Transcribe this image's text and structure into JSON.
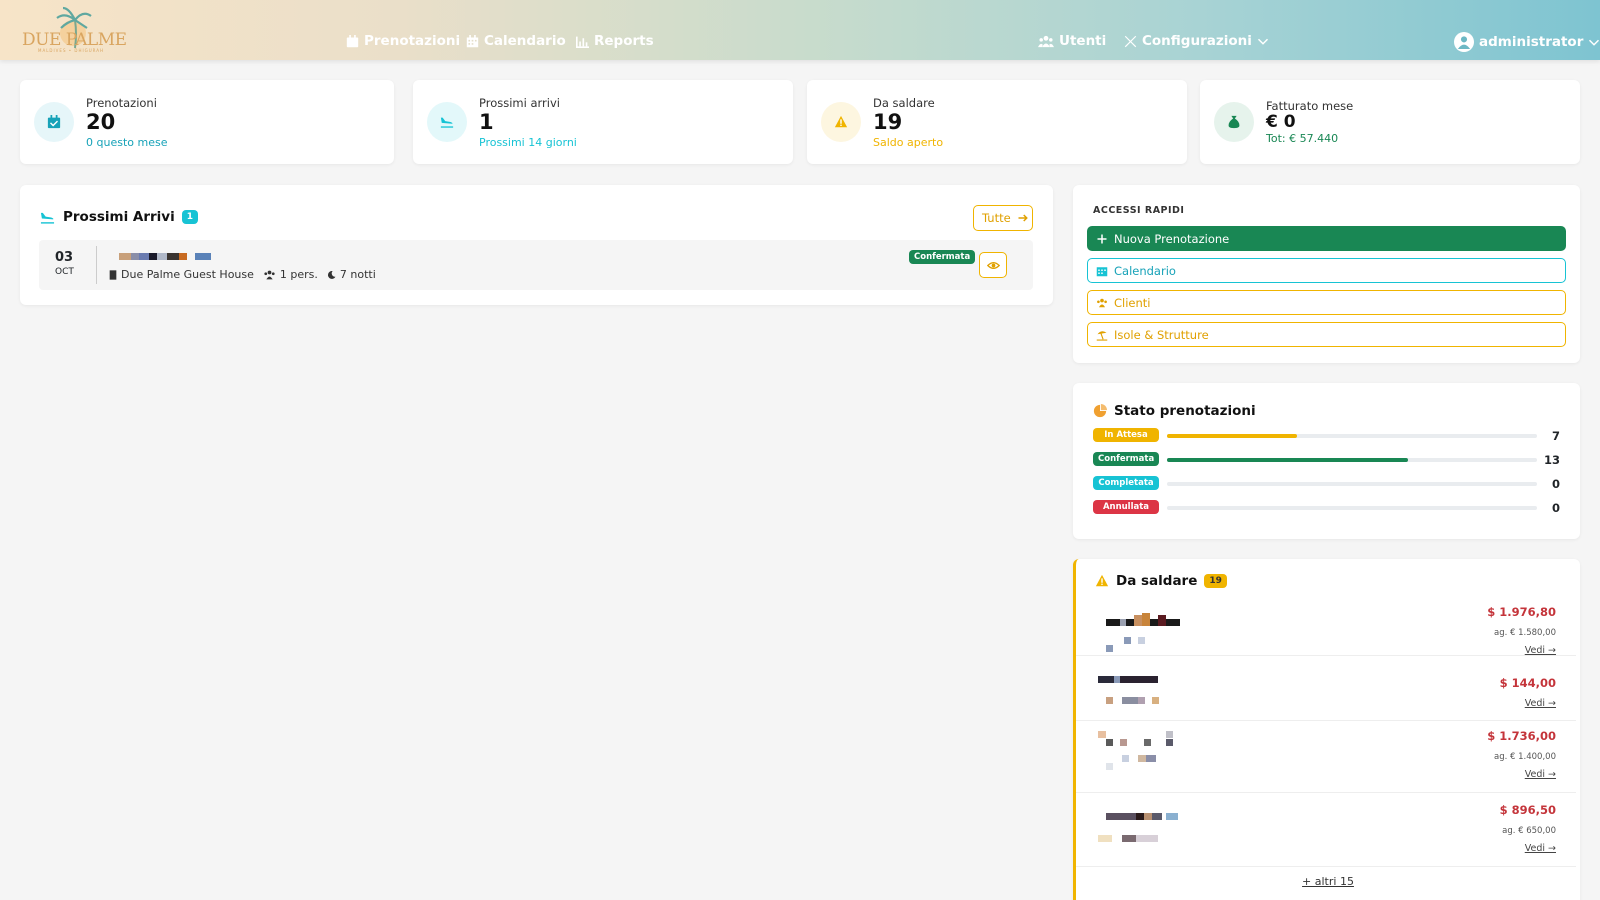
{
  "nav": {
    "logo_text": "DUE PALME",
    "logo_sub": "MALDIVES • DHIGURAH",
    "links": [
      {
        "label": "Prenotazioni",
        "icon": "calendar-check-icon"
      },
      {
        "label": "Calendario",
        "icon": "calendar-icon"
      },
      {
        "label": "Reports",
        "icon": "chart-icon"
      }
    ],
    "utenti": "Utenti",
    "configurazioni": "Configurazioni",
    "user": "administrator"
  },
  "stats": [
    {
      "label": "Prenotazioni",
      "value": "20",
      "sub": "0 questo mese",
      "color": "#17a2b8",
      "icon": "calendar-check-icon"
    },
    {
      "label": "Prossimi arrivi",
      "value": "1",
      "sub": "Prossimi 14 giorni",
      "color": "#17c3d4",
      "icon": "plane-arrival-icon"
    },
    {
      "label": "Da saldare",
      "value": "19",
      "sub": "Saldo aperto",
      "color": "#f0b400",
      "icon": "warning-icon"
    },
    {
      "label": "Fatturato mese",
      "value": "€ 0",
      "sub": "Tot: € 57.440",
      "color": "#198754",
      "icon": "money-bag-icon"
    }
  ],
  "arrivals": {
    "title": "Prossimi Arrivi",
    "count": "1",
    "all_button": "Tutte",
    "items": [
      {
        "day": "03",
        "month": "OCT",
        "property": "Due Palme Guest House",
        "guests": "1 pers.",
        "nights": "7 notti",
        "status": "Confermata"
      }
    ]
  },
  "quick": {
    "title": "ACCESSI RAPIDI",
    "new_booking": "Nuova Prenotazione",
    "calendar": "Calendario",
    "clients": "Clienti",
    "islands": "Isole & Strutture"
  },
  "status": {
    "title": "Stato prenotazioni",
    "rows": [
      {
        "label": "In Attesa",
        "count": 7,
        "fraction": 0.35,
        "color": "#f0b400"
      },
      {
        "label": "Confermata",
        "count": 13,
        "fraction": 0.65,
        "color": "#198754"
      },
      {
        "label": "Completata",
        "count": 0,
        "fraction": 0,
        "color": "#17c3d4"
      },
      {
        "label": "Annullata",
        "count": 0,
        "fraction": 0,
        "color": "#dc3545"
      }
    ]
  },
  "due": {
    "title": "Da saldare",
    "count": "19",
    "items": [
      {
        "amount": "$ 1.976,80",
        "sub": "ag. € 1.580,00",
        "link": "Vedi →"
      },
      {
        "amount": "$ 144,00",
        "sub": "",
        "link": "Vedi →"
      },
      {
        "amount": "$ 1.736,00",
        "sub": "ag. € 1.400,00",
        "link": "Vedi →"
      },
      {
        "amount": "$ 896,50",
        "sub": "ag. € 650,00",
        "link": "Vedi →"
      }
    ],
    "more": "+ altri 15"
  }
}
